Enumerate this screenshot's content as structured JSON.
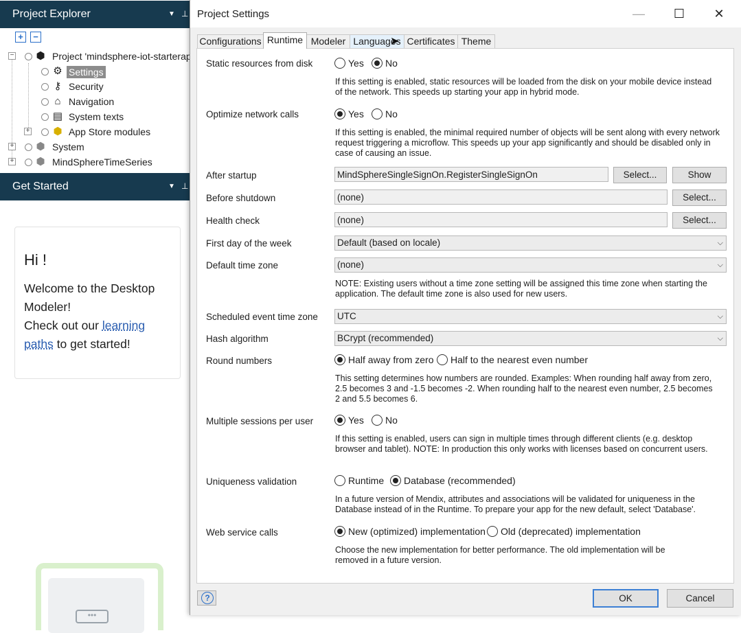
{
  "explorer": {
    "title": "Project Explorer",
    "tree": [
      {
        "label": "Project 'mindsphere-iot-starterapp'",
        "icon": "package-icon"
      },
      {
        "label": "Settings",
        "icon": "gear-icon"
      },
      {
        "label": "Security",
        "icon": "key-icon"
      },
      {
        "label": "Navigation",
        "icon": "home-icon"
      },
      {
        "label": "System texts",
        "icon": "text-icon"
      },
      {
        "label": "App Store modules",
        "icon": "module-icon"
      },
      {
        "label": "System",
        "icon": "package-icon"
      },
      {
        "label": "MindSphereTimeSeries",
        "icon": "package-icon"
      }
    ]
  },
  "get_started": {
    "title": "Get Started",
    "greeting": "Hi !",
    "line1": "Welcome to the Desktop Modeler!",
    "line2_pre": "Check out our",
    "link": "learning paths",
    "line2_post": "to get started!"
  },
  "dialog": {
    "title": "Project Settings",
    "tabs": [
      "Configurations",
      "Runtime",
      "Modeler",
      "Languages",
      "Certificates",
      "Theme"
    ],
    "active_tab": "Runtime",
    "static_resources": {
      "label": "Static resources from disk",
      "yes": "Yes",
      "no": "No",
      "selected": "No",
      "desc": "If this setting is enabled, static resources will be loaded from the disk on your mobile device instead of the network. This speeds up starting your app in hybrid mode."
    },
    "optimize": {
      "label": "Optimize network calls",
      "yes": "Yes",
      "no": "No",
      "selected": "Yes",
      "desc": "If this setting is enabled, the minimal required number of objects will be sent along with every network request triggering a microflow. This speeds up your app significantly and should be disabled only in case of causing an issue."
    },
    "after_startup": {
      "label": "After startup",
      "value": "MindSphereSingleSignOn.RegisterSingleSignOn",
      "select": "Select...",
      "show": "Show"
    },
    "before_shutdown": {
      "label": "Before shutdown",
      "value": "(none)",
      "select": "Select..."
    },
    "health_check": {
      "label": "Health check",
      "value": "(none)",
      "select": "Select..."
    },
    "first_day": {
      "label": "First day of the week",
      "value": "Default (based on locale)"
    },
    "default_tz": {
      "label": "Default time zone",
      "value": "(none)",
      "desc": "NOTE: Existing users without a time zone setting will be assigned this time zone when starting the application. The default time zone is also used for new users."
    },
    "scheduled_tz": {
      "label": "Scheduled event time zone",
      "value": "UTC"
    },
    "hash": {
      "label": "Hash algorithm",
      "value": "BCrypt (recommended)"
    },
    "round": {
      "label": "Round numbers",
      "opt1": "Half away from zero",
      "opt2": "Half to the nearest even number",
      "selected": "Half away from zero",
      "desc": "This setting determines how numbers are rounded. Examples: When rounding half away from zero, 2.5 becomes 3 and -1.5 becomes -2. When rounding half to the nearest even number, 2.5 becomes 2 and 5.5 becomes 6."
    },
    "multi_sessions": {
      "label": "Multiple sessions per user",
      "yes": "Yes",
      "no": "No",
      "selected": "Yes",
      "desc": "If this setting is enabled, users can sign in multiple times through different clients (e.g. desktop browser and tablet). NOTE: In production this only works with licenses based on concurrent users."
    },
    "uniqueness": {
      "label": "Uniqueness validation",
      "opt1": "Runtime",
      "opt2": "Database (recommended)",
      "selected": "Database (recommended)",
      "desc": "In a future version of Mendix, attributes and associations will be validated for uniqueness in the Database instead of in the Runtime. To prepare your app for the new default, select 'Database'."
    },
    "web_service": {
      "label": "Web service calls",
      "opt1": "New (optimized) implementation",
      "opt2": "Old (deprecated) implementation",
      "selected": "New (optimized) implementation",
      "desc": "Choose the new implementation for better performance. The old implementation will be removed in a future version."
    },
    "ok": "OK",
    "cancel": "Cancel"
  },
  "colors": {
    "panel_header": "#173a4f",
    "ok_border": "#3c7fd4",
    "link": "#2a5db0"
  }
}
